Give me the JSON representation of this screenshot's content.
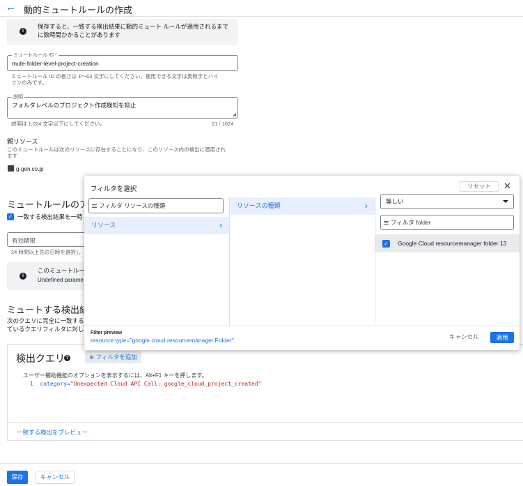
{
  "header": {
    "title": "動的ミュートルールの作成"
  },
  "info_banner": {
    "text_line1": "保存すると、一致する検出結果に動的ミュート ルールが適用されるまで",
    "text_line2": "に数時間かかることがあります"
  },
  "mute_rule_id": {
    "label": "ミュートルール ID *",
    "value": "mute-folder-level-project-creation",
    "hint_line1": "ミュートルール ID の長さは 1〜63 文字にしてください。使用できる文字は英数字とハイ",
    "hint_line2": "フンのみです。"
  },
  "description": {
    "label": "説明",
    "value": "フォルダレベルのプロジェクト作成検知を抑止",
    "hint": "説明は 1,024 文字以下にしてください。",
    "counter": "21 / 1024"
  },
  "parent_resource": {
    "heading": "親リソース",
    "text_line1": "このミュートルールは次のリソースに存在することになり、このリソース内の検出に適用され",
    "text_line2": "ます",
    "org": "g-gen.co.jp"
  },
  "mute_action": {
    "heading": "ミュートルールのアク",
    "checkbox_label": "一致する検出結果を一時",
    "expiry_label": "有効期限",
    "expiry_hint": "24 時間以上先の日時を選択し",
    "info_line1": "このミュートルー",
    "info_line2": "Undefined parame"
  },
  "findings": {
    "heading": "ミュートする検出結果",
    "text_line1": "次のクエリに完全に一致する",
    "text_line2": "ているクエリフィルタに対し"
  },
  "query": {
    "title": "検出クエリ",
    "add_filter": "フィルタを追加",
    "accessibility_hint": "ユーザー補助機能のオプションを表示するには、Alt+F1 キーを押します。",
    "line_number": "1",
    "code_key": "category=",
    "code_value": "\"Unexpected Cloud API Call: google_cloud_project_created\"",
    "preview_link": "一致する検出をプレビュー"
  },
  "footer": {
    "save": "保存",
    "cancel": "キャンセル"
  },
  "filter_dialog": {
    "title": "フィルタを選択",
    "reset": "リセット",
    "close": "✕",
    "col1_filter_prefix": "フィルタ",
    "col1_filter_placeholder": "リソースの種類",
    "col1_item": "リソース",
    "col2_item": "リソースの種類",
    "operator": "等しい",
    "col3_filter_prefix": "フィルタ",
    "col3_filter_value": "folder",
    "option_label": "Google Cloud resourcemanager folder 13",
    "preview_label": "Filter preview",
    "preview_value": "resource.type=\"google.cloud.resourcemanager.Folder\"",
    "cancel": "キャンセル",
    "apply": "適用"
  },
  "colors": {
    "accent": "#1a73e8",
    "code_string": "#c5221f",
    "info_bg": "#f1f3f4"
  },
  "icons": {
    "back": "arrow-left-icon",
    "info": "info-icon",
    "org": "building-icon",
    "help": "help-icon",
    "add": "add-circle-icon",
    "filter": "filter-icon",
    "chevron": "chevron-right-icon",
    "close": "close-icon",
    "dropdown": "caret-down-icon",
    "check": "check-icon"
  }
}
